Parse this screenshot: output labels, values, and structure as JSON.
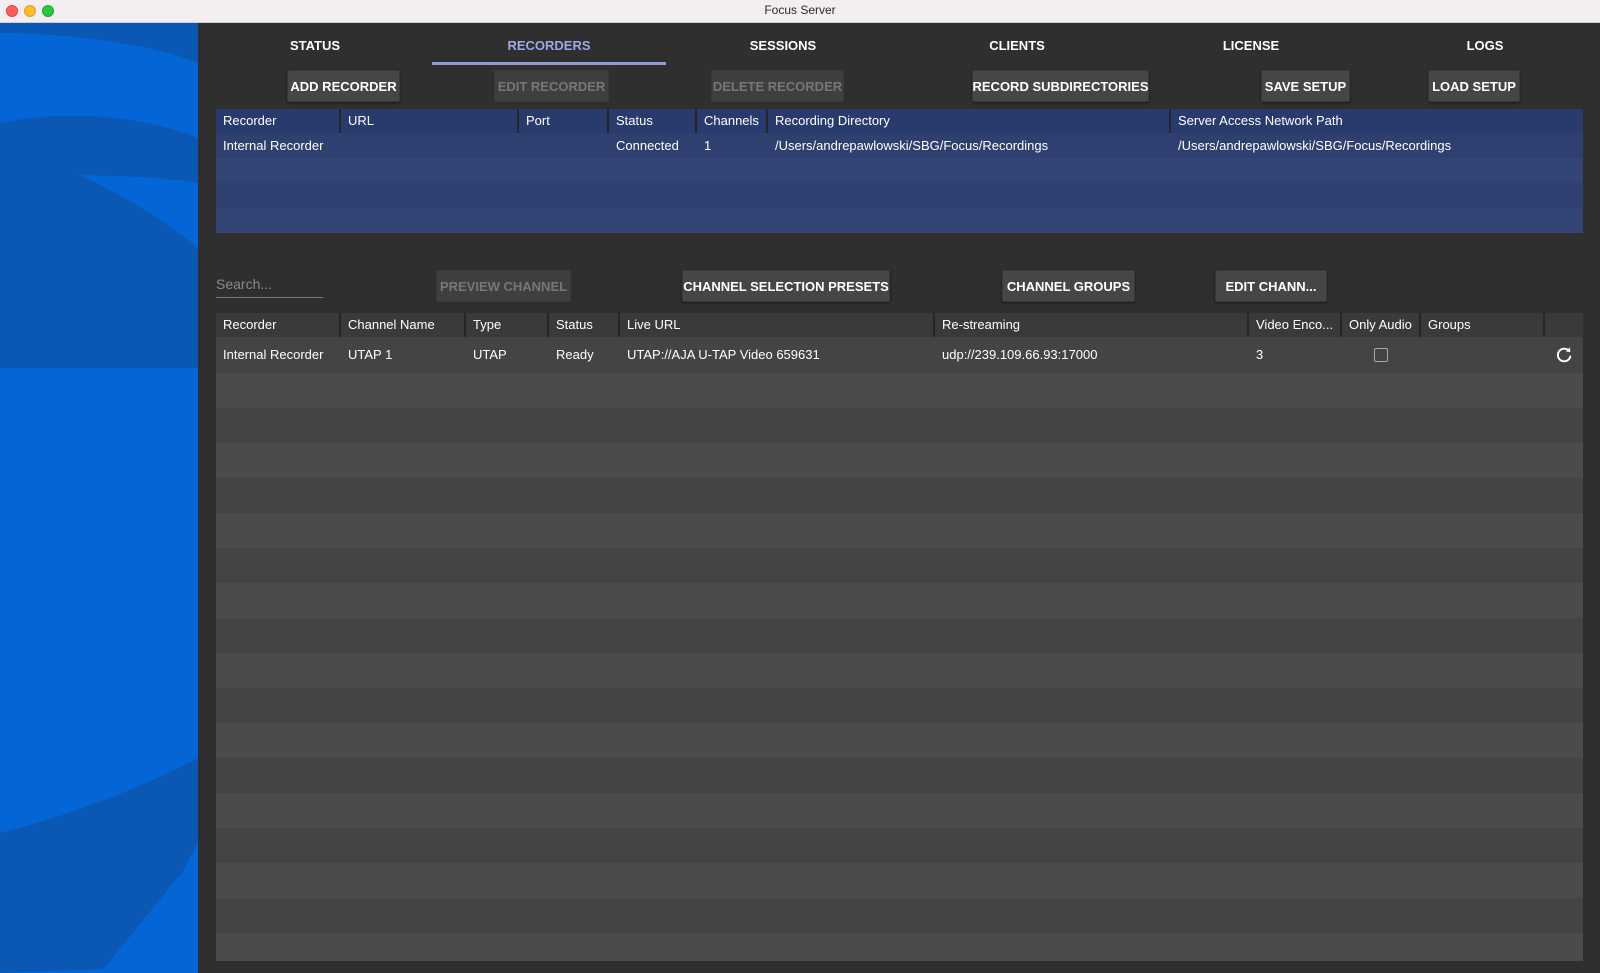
{
  "window": {
    "title": "Focus Server"
  },
  "tabs": [
    {
      "label": "STATUS"
    },
    {
      "label": "RECORDERS",
      "active": true
    },
    {
      "label": "SESSIONS"
    },
    {
      "label": "CLIENTS"
    },
    {
      "label": "LICENSE"
    },
    {
      "label": "LOGS"
    }
  ],
  "recorder_toolbar": {
    "add": "ADD RECORDER",
    "edit": "EDIT RECORDER",
    "delete": "DELETE RECORDER",
    "subdirs": "RECORD SUBDIRECTORIES",
    "save": "SAVE SETUP",
    "load": "LOAD SETUP"
  },
  "recorders_table": {
    "columns": [
      "Recorder",
      "URL",
      "Port",
      "Status",
      "Channels",
      "Recording Directory",
      "Server Access Network Path"
    ],
    "rows": [
      [
        "Internal Recorder",
        "",
        "",
        "Connected",
        "1",
        "/Users/andrepawlowski/SBG/Focus/Recordings",
        "/Users/andrepawlowski/SBG/Focus/Recordings"
      ]
    ]
  },
  "channel_toolbar": {
    "search_placeholder": "Search...",
    "preview": "PREVIEW CHANNEL",
    "presets": "CHANNEL SELECTION PRESETS",
    "groups": "CHANNEL GROUPS",
    "edit": "EDIT CHANN..."
  },
  "channels_table": {
    "columns": [
      "Recorder",
      "Channel Name",
      "Type",
      "Status",
      "Live URL",
      "Re-streaming",
      "Video Enco...",
      "Only Audio",
      "Groups",
      ""
    ],
    "rows": [
      {
        "recorder": "Internal Recorder",
        "name": "UTAP 1",
        "type": "UTAP",
        "status": "Ready",
        "live_url": "UTAP://AJA U-TAP Video 659631",
        "restreaming": "udp://239.109.66.93:17000",
        "video_encoders": "3",
        "only_audio": false,
        "groups": ""
      }
    ]
  },
  "colors": {
    "sidebar_blue": "#0466d6",
    "accent_tab": "#9fa8e2",
    "recorder_table_bg": "#2e3f70"
  }
}
